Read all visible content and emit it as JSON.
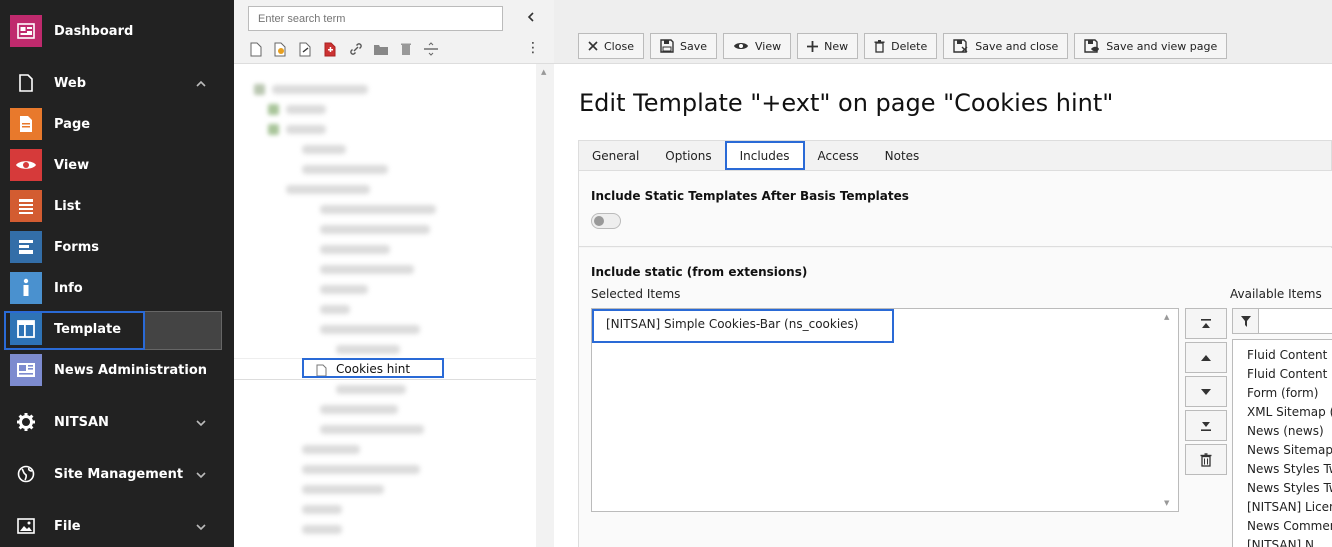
{
  "module_menu": {
    "items": [
      {
        "label": "Dashboard",
        "icon": "dashboard-icon",
        "color": "#bf2a6d"
      },
      {
        "label": "Web",
        "icon": "web-page-icon",
        "group": true
      },
      {
        "label": "Page",
        "icon": "page-module-icon",
        "color": "#e8792c"
      },
      {
        "label": "View",
        "icon": "view-eye-icon",
        "color": "#d63a3a"
      },
      {
        "label": "List",
        "icon": "list-module-icon",
        "color": "#d35c31"
      },
      {
        "label": "Forms",
        "icon": "forms-module-icon",
        "color": "#336ea8"
      },
      {
        "label": "Info",
        "icon": "info-module-icon",
        "color": "#4a91cf"
      },
      {
        "label": "Template",
        "icon": "template-module-icon",
        "color": "#2e73b6"
      },
      {
        "label": "News Administration",
        "icon": "news-admin-icon",
        "color": "#7d8bcf"
      },
      {
        "label": "NITSAN",
        "icon": "gear-icon",
        "group": true
      },
      {
        "label": "Site Management",
        "icon": "globe-icon",
        "group": true
      },
      {
        "label": "File",
        "icon": "image-file-icon",
        "group": true
      }
    ]
  },
  "page_tree": {
    "search_placeholder": "Enter search term",
    "selected_page": "Cookies hint"
  },
  "docheader": {
    "buttons": [
      {
        "label": "Close",
        "icon": "close-icon"
      },
      {
        "label": "Save",
        "icon": "save-icon"
      },
      {
        "label": "View",
        "icon": "eye-icon"
      },
      {
        "label": "New",
        "icon": "plus-icon"
      },
      {
        "label": "Delete",
        "icon": "trash-icon"
      },
      {
        "label": "Save and close",
        "icon": "save-close-icon"
      },
      {
        "label": "Save and view page",
        "icon": "save-view-icon"
      }
    ]
  },
  "main": {
    "title": "Edit Template \"+ext\" on page \"Cookies hint\"",
    "tabs": [
      "General",
      "Options",
      "Includes",
      "Access",
      "Notes"
    ],
    "active_tab": "Includes",
    "section1_title": "Include Static Templates After Basis Templates",
    "toggle_on": false,
    "section2_title": "Include static (from extensions)",
    "selected_label": "Selected Items",
    "available_label": "Available Items",
    "selected_items": [
      "[NITSAN] Simple Cookies-Bar (ns_cookies)"
    ],
    "available_items": [
      "Fluid Content E",
      "Fluid Content E",
      "Form (form)",
      "XML Sitemap (",
      "News (news)",
      "News Sitemap",
      "News Styles Tw",
      "News Styles Tw",
      "[NITSAN] Licen",
      "News Commen",
      "[NITSAN] N"
    ]
  }
}
